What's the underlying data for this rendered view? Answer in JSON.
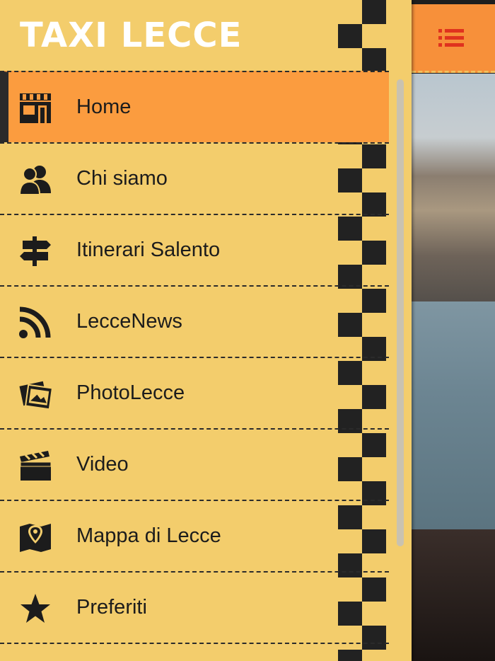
{
  "drawer": {
    "title": "TAXI LECCE",
    "active_index": 0,
    "items": [
      {
        "label": "Home",
        "icon": "storefront-icon"
      },
      {
        "label": "Chi siamo",
        "icon": "users-icon"
      },
      {
        "label": "Itinerari Salento",
        "icon": "signpost-icon"
      },
      {
        "label": "LecceNews",
        "icon": "rss-icon"
      },
      {
        "label": "PhotoLecce",
        "icon": "photos-icon"
      },
      {
        "label": "Video",
        "icon": "clapperboard-icon"
      },
      {
        "label": "Mappa di Lecce",
        "icon": "map-pin-icon"
      },
      {
        "label": "Preferiti",
        "icon": "star-icon"
      }
    ]
  },
  "header": {
    "menu_icon": "list-menu-icon"
  },
  "colors": {
    "drawer_bg": "#f3cd6c",
    "active_bg": "#fb9c3f",
    "header_bg": "#f7903a",
    "menu_icon": "#e0321e",
    "text": "#1c1c1c"
  }
}
